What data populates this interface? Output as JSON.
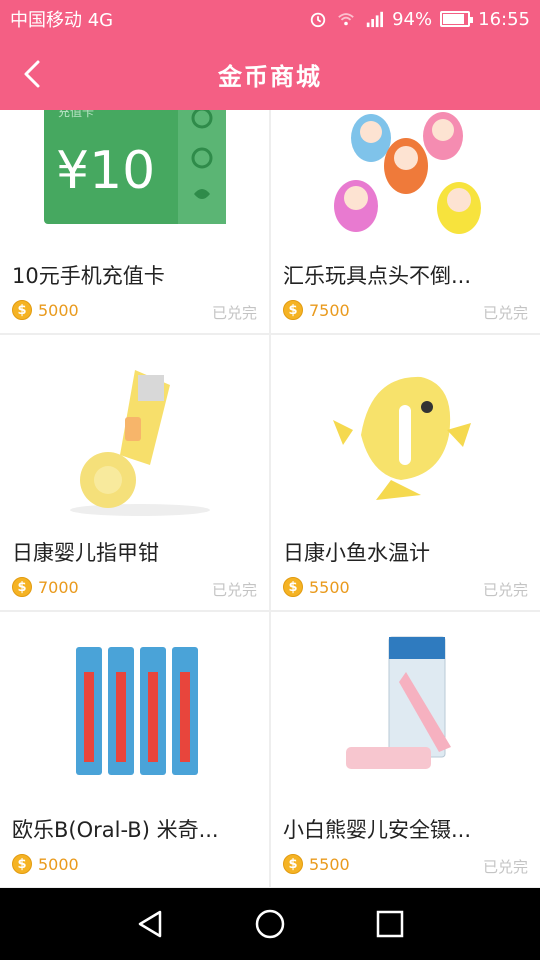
{
  "status_bar": {
    "carrier": "中国移动 4G",
    "battery_percent": "94%",
    "time": "16:55",
    "icons": [
      "alarm-icon",
      "wifi-icon",
      "signal-icon",
      "battery-icon"
    ]
  },
  "header": {
    "title": "金币商城",
    "back_icon": "back-arrow-icon"
  },
  "colors": {
    "primary": "#f45f84",
    "price": "#e99a1d",
    "coin": "#f5b324",
    "status": "#c4c4c4"
  },
  "products": [
    {
      "name": "10元手机充值卡",
      "price": "5000",
      "status": "已兑完",
      "card_label": "充值卡",
      "card_value": "¥10",
      "image": "phone-card-image"
    },
    {
      "name": "汇乐玩具点头不倒...",
      "price": "7500",
      "status": "已兑完",
      "image": "tumbler-toy-image"
    },
    {
      "name": "日康婴儿指甲钳",
      "price": "7000",
      "status": "已兑完",
      "image": "nail-clipper-image"
    },
    {
      "name": "日康小鱼水温计",
      "price": "5500",
      "status": "已兑完",
      "image": "fish-thermometer-image"
    },
    {
      "name": "欧乐B(Oral-B) 米奇...",
      "price": "5000",
      "status": "",
      "image": "toothbrush-image"
    },
    {
      "name": "小白熊婴儿安全镊...",
      "price": "5500",
      "status": "已兑完",
      "image": "tweezers-image"
    }
  ],
  "nav": {
    "icons": [
      "back-triangle-icon",
      "home-circle-icon",
      "recents-square-icon"
    ]
  }
}
